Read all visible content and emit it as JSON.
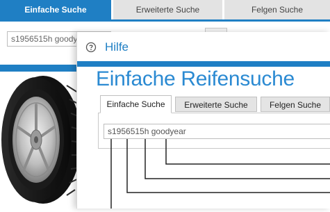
{
  "background": {
    "tabs": [
      {
        "label": "Einfache Suche",
        "active": true
      },
      {
        "label": "Erweiterte Suche",
        "active": false
      },
      {
        "label": "Felgen Suche",
        "active": false
      }
    ],
    "search_value": "s1956515h goody",
    "accent_color": "#1f7fc4"
  },
  "help": {
    "header_icon": "question-circle-icon",
    "header_label": "Hilfe",
    "title": "Einfache Reifensuche",
    "tabs": [
      {
        "label": "Einfache Suche",
        "active": true
      },
      {
        "label": "Erweiterte Suche",
        "active": false
      },
      {
        "label": "Felgen Suche",
        "active": false
      }
    ],
    "search_value": "s1956515h goodyear",
    "title_color": "#2b8ad2"
  }
}
